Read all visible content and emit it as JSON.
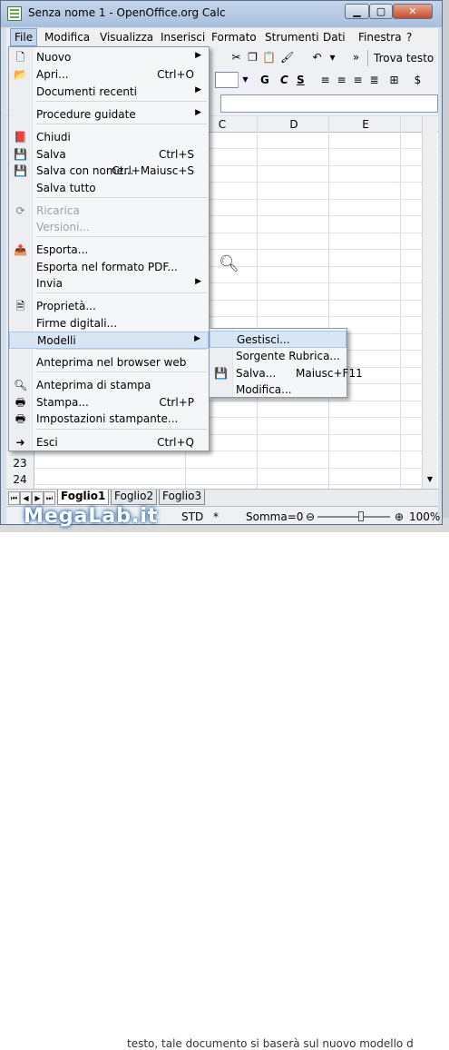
{
  "window": {
    "title": "Senza nome 1 - OpenOffice.org Calc"
  },
  "menubar": [
    "File",
    "Modifica",
    "Visualizza",
    "Inserisci",
    "Formato",
    "Strumenti",
    "Dati",
    "Finestra",
    "?"
  ],
  "toolbar": {
    "find_label": "Trova testo"
  },
  "format_buttons": [
    "G",
    "C",
    "S"
  ],
  "columns": [
    "C",
    "D",
    "E"
  ],
  "rows": [
    "23",
    "24"
  ],
  "file_menu": {
    "items": [
      {
        "label": "Nuovo",
        "shortcut": "",
        "submenu": true,
        "icon": "new-icon",
        "disabled": false
      },
      {
        "label": "Apri...",
        "shortcut": "Ctrl+O",
        "submenu": false,
        "icon": "open-folder-icon",
        "disabled": false
      },
      {
        "label": "Documenti recenti",
        "shortcut": "",
        "submenu": true,
        "icon": "",
        "disabled": false
      },
      {
        "label": "Procedure guidate",
        "shortcut": "",
        "submenu": true,
        "icon": "",
        "disabled": false
      },
      {
        "label": "Chiudi",
        "shortcut": "",
        "submenu": false,
        "icon": "close-doc-icon",
        "disabled": false
      },
      {
        "label": "Salva",
        "shortcut": "Ctrl+S",
        "submenu": false,
        "icon": "save-icon",
        "disabled": false
      },
      {
        "label": "Salva con nome...",
        "shortcut": "Ctrl+Maiusc+S",
        "submenu": false,
        "icon": "save-as-icon",
        "disabled": false
      },
      {
        "label": "Salva tutto",
        "shortcut": "",
        "submenu": false,
        "icon": "",
        "disabled": false
      },
      {
        "label": "Ricarica",
        "shortcut": "",
        "submenu": false,
        "icon": "reload-icon",
        "disabled": true
      },
      {
        "label": "Versioni...",
        "shortcut": "",
        "submenu": false,
        "icon": "",
        "disabled": true
      },
      {
        "label": "Esporta...",
        "shortcut": "",
        "submenu": false,
        "icon": "export-icon",
        "disabled": false
      },
      {
        "label": "Esporta nel formato PDF...",
        "shortcut": "",
        "submenu": false,
        "icon": "",
        "disabled": false
      },
      {
        "label": "Invia",
        "shortcut": "",
        "submenu": true,
        "icon": "",
        "disabled": false
      },
      {
        "label": "Proprietà...",
        "shortcut": "",
        "submenu": false,
        "icon": "properties-icon",
        "disabled": false
      },
      {
        "label": "Firme digitali...",
        "shortcut": "",
        "submenu": false,
        "icon": "",
        "disabled": false
      },
      {
        "label": "Modelli",
        "shortcut": "",
        "submenu": true,
        "icon": "",
        "disabled": false
      },
      {
        "label": "Anteprima nel browser web",
        "shortcut": "",
        "submenu": false,
        "icon": "",
        "disabled": false
      },
      {
        "label": "Anteprima di stampa",
        "shortcut": "",
        "submenu": false,
        "icon": "print-preview-icon",
        "disabled": false
      },
      {
        "label": "Stampa...",
        "shortcut": "Ctrl+P",
        "submenu": false,
        "icon": "print-icon",
        "disabled": false
      },
      {
        "label": "Impostazioni stampante...",
        "shortcut": "",
        "submenu": false,
        "icon": "printer-settings-icon",
        "disabled": false
      },
      {
        "label": "Esci",
        "shortcut": "Ctrl+Q",
        "submenu": false,
        "icon": "exit-icon",
        "disabled": false
      }
    ]
  },
  "templates_submenu": {
    "items": [
      {
        "label": "Gestisci...",
        "shortcut": "",
        "icon": ""
      },
      {
        "label": "Sorgente Rubrica...",
        "shortcut": "",
        "icon": ""
      },
      {
        "label": "Salva...",
        "shortcut": "Maiusc+F11",
        "icon": "save-template-icon"
      },
      {
        "label": "Modifica...",
        "shortcut": "",
        "icon": ""
      }
    ]
  },
  "sheet_tabs": [
    "Foglio1",
    "Foglio2",
    "Foglio3"
  ],
  "status": {
    "mode": "STD",
    "modified": "*",
    "sum": "Somma=0",
    "zoom": "100%"
  },
  "watermark": {
    "logo_text": "MegaLab.it"
  },
  "background_text": "testo, tale documento si baserà sul nuovo modello d"
}
